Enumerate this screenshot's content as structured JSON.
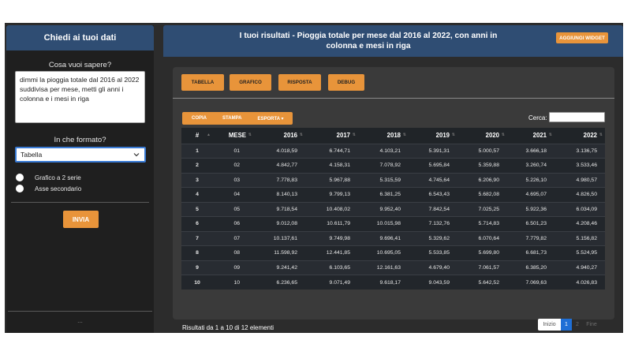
{
  "sidebar": {
    "title": "Chiedi ai tuoi dati",
    "question_label": "Cosa vuoi sapere?",
    "question_value": "dimmi la pioggia totale dal 2016 al 2022 suddivisa per mese, metti gli anni i colonna e i mesi in riga",
    "format_label": "In che formato?",
    "format_value": "Tabella",
    "option_two_series": "Grafico a 2 serie",
    "option_secondary_axis": "Asse secondario",
    "send_label": "INVIA",
    "footer_dots": "..."
  },
  "header": {
    "title": "I tuoi risultati - Pioggia totale per mese dal 2016 al 2022, con anni in colonna e mesi in riga",
    "add_widget_label": "AGGIUNGI WIDGET"
  },
  "tabs": [
    {
      "label": "TABELLA"
    },
    {
      "label": "GRAFICO"
    },
    {
      "label": "RISPOSTA"
    },
    {
      "label": "DEBUG"
    }
  ],
  "tools": {
    "copy": "COPIA",
    "print": "STAMPA",
    "export": "ESPORTA ▾"
  },
  "search_label": "Cerca:",
  "table": {
    "columns": [
      "#",
      "MESE",
      "2016",
      "2017",
      "2018",
      "2019",
      "2020",
      "2021",
      "2022"
    ],
    "rows": [
      [
        "1",
        "01",
        "4.018,59",
        "6.744,71",
        "4.103,21",
        "5.391,31",
        "5.000,57",
        "3.666,18",
        "3.136,75"
      ],
      [
        "2",
        "02",
        "4.842,77",
        "4.158,31",
        "7.078,92",
        "5.695,84",
        "5.359,88",
        "3.260,74",
        "3.533,46"
      ],
      [
        "3",
        "03",
        "7.778,83",
        "5.967,88",
        "5.315,59",
        "4.745,64",
        "6.206,90",
        "5.226,10",
        "4.980,57"
      ],
      [
        "4",
        "04",
        "8.140,13",
        "9.799,13",
        "6.381,25",
        "6.543,43",
        "5.682,08",
        "4.695,07",
        "4.826,50"
      ],
      [
        "5",
        "05",
        "9.718,54",
        "10.408,02",
        "9.952,40",
        "7.842,54",
        "7.025,25",
        "5.922,36",
        "6.034,09"
      ],
      [
        "6",
        "06",
        "9.012,08",
        "10.611,79",
        "10.015,98",
        "7.132,76",
        "5.714,83",
        "6.501,23",
        "4.208,46"
      ],
      [
        "7",
        "07",
        "10.137,61",
        "9.749,98",
        "9.696,41",
        "5.329,62",
        "6.070,64",
        "7.779,82",
        "5.156,82"
      ],
      [
        "8",
        "08",
        "11.598,92",
        "12.441,85",
        "10.695,05",
        "5.533,85",
        "5.699,80",
        "6.681,73",
        "5.524,95"
      ],
      [
        "9",
        "09",
        "9.241,42",
        "6.103,65",
        "12.161,63",
        "4.679,40",
        "7.061,57",
        "6.385,20",
        "4.940,27"
      ],
      [
        "10",
        "10",
        "6.236,65",
        "9.071,49",
        "9.618,17",
        "9.043,59",
        "5.642,52",
        "7.069,63",
        "4.026,83"
      ]
    ]
  },
  "summary": "Risultati da 1 a 10 di 12 elementi",
  "pagination": {
    "first": "Inizio",
    "page1": "1",
    "page2": "2",
    "last": "Fine"
  }
}
